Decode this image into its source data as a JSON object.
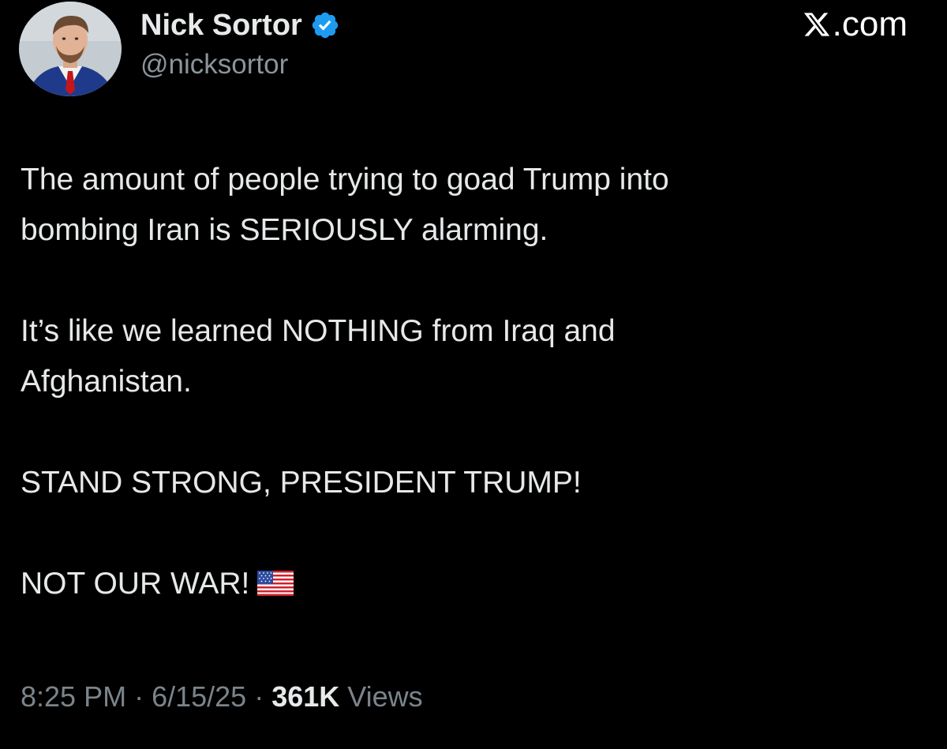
{
  "author": {
    "display_name": "Nick Sortor",
    "handle": "@nicksortor",
    "verified_icon": "verified-badge-icon",
    "verified_color": "#1d9bf0"
  },
  "brand": {
    "icon": "x-logo-icon",
    "suffix": ".com"
  },
  "tweet": {
    "paragraphs": [
      "The amount of people trying to goad Trump into",
      "bombing Iran is SERIOUSLY alarming.",
      "It’s like we learned NOTHING from Iraq and",
      "Afghanistan.",
      "STAND STRONG, PRESIDENT TRUMP!",
      "NOT OUR WAR!"
    ],
    "emoji": "us-flag-icon"
  },
  "meta": {
    "time": "8:25 PM",
    "separator_1": " · ",
    "date": "6/15/25",
    "separator_2": " · ",
    "views_count": "361K",
    "views_label": " Views"
  },
  "colors": {
    "background": "#000000",
    "text_primary": "#e7e9ea",
    "text_secondary": "#8b949a"
  }
}
